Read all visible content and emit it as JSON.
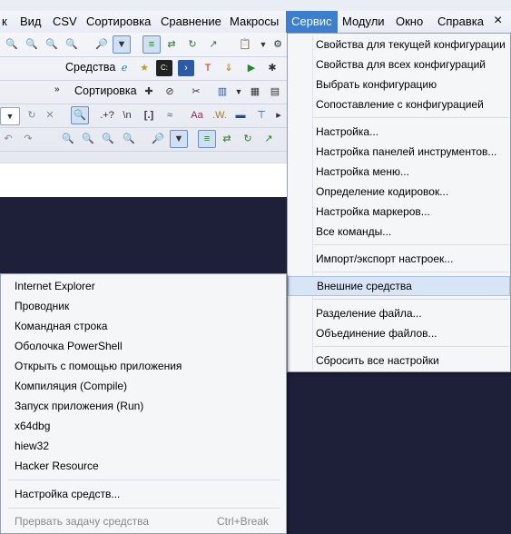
{
  "menubar": {
    "items": [
      "к",
      "Вид",
      "CSV",
      "Сортировка",
      "Сравнение",
      "Макросы",
      "Сервис",
      "Модули",
      "Окно",
      "Справка"
    ]
  },
  "toolbar": {
    "tools_label": "Средства",
    "sort_label": "Сортировка",
    "regex_label": ".+?",
    "newline_label": "\\n",
    "brackets_label": "[.]",
    "case_label": "Aa",
    "word_label": ".W."
  },
  "service_menu": {
    "items": [
      "Свойства для текущей конфигурации",
      "Свойства для всех конфигураций",
      "Выбрать конфигурацию",
      "Сопоставление с конфигурацией",
      "Настройка...",
      "Настройка панелей инструментов...",
      "Настройка меню...",
      "Определение кодировок...",
      "Настройка маркеров...",
      "Все команды...",
      "Импорт/экспорт настроек...",
      "Внешние средства",
      "Разделение файла...",
      "Объединение файлов...",
      "Сбросить все настройки"
    ]
  },
  "external_tools_menu": {
    "items": [
      "Internet Explorer",
      "Проводник",
      "Командная строка",
      "Оболочка PowerShell",
      "Открыть с помощью приложения",
      "Компиляция (Compile)",
      "Запуск приложения (Run)",
      "x64dbg",
      "hiew32",
      "Hacker Resource",
      "Настройка средств...",
      "Прервать задачу средства"
    ],
    "abort_shortcut": "Ctrl+Break"
  }
}
